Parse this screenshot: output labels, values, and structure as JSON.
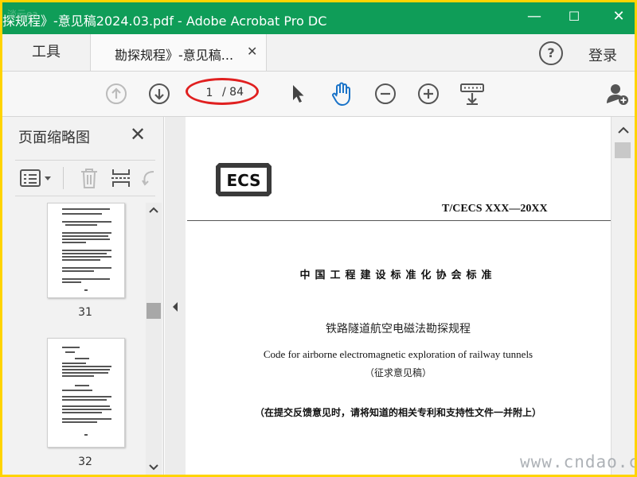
{
  "window": {
    "title": "探规程》-意见稿2024.03.pdf - Adobe Acrobat Pro DC",
    "controls": {
      "minimize": "—",
      "maximize": "☐",
      "close": "✕"
    }
  },
  "tabs": {
    "tools_label": "工具",
    "document_label": "勘探规程》-意见稿...",
    "close_symbol": "✕",
    "help_symbol": "?",
    "login_label": "登录"
  },
  "toolbar": {
    "current_page": "1",
    "total_pages": "/ 84"
  },
  "sidebar": {
    "title": "页面缩略图",
    "close_symbol": "✕",
    "thumbnails": [
      {
        "label": "31"
      },
      {
        "label": "32"
      }
    ]
  },
  "document": {
    "logo_text": "ECS",
    "standard_no": "T/CECS XXX—20XX",
    "association": "中国工程建设标准化协会标准",
    "title_cn": "铁路隧道航空电磁法勘探规程",
    "title_en": "Code for airborne electromagnetic exploration of railway tunnels",
    "draft_label": "（征求意见稿）",
    "notice": "（在提交反馈意见时，请将知道的相关专利和支持性文件一并附上）"
  },
  "watermark": {
    "bottom_right": "www.cndao.com",
    "top_left": "淡云ea"
  },
  "colors": {
    "titlebar": "#0f9d58",
    "frame_border": "#ffd400",
    "hand_tool_active": "#1a73c8",
    "page_indicator_ring": "#e02020"
  }
}
